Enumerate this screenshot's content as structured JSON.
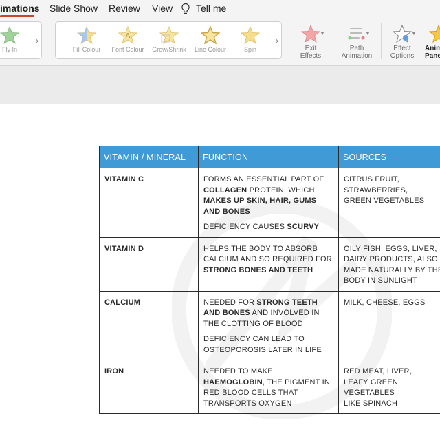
{
  "tabs": [
    {
      "label": "imations",
      "active": true
    },
    {
      "label": "Slide Show"
    },
    {
      "label": "Review"
    },
    {
      "label": "View"
    },
    {
      "label": "Tell me"
    }
  ],
  "ribbon": {
    "fly_in": "Fly In",
    "effects": [
      "Fill Colour",
      "Font Colour",
      "Grow/Shrink",
      "Line Colour",
      "Spin"
    ],
    "exit_effects": "Exit Effects",
    "path_animation": "Path Animation",
    "effect_options": "Effect Options",
    "animation_pane": "Animation Pane"
  },
  "table": {
    "headers": [
      "VITAMIN / MINERAL",
      "FUNCTION",
      "SOURCES"
    ],
    "rows": [
      {
        "name": "VITAMIN C",
        "function": [
          [
            {
              "t": "FORMS AN ESSENTIAL PART OF "
            },
            {
              "t": "COLLAGEN",
              "b": true
            },
            {
              "t": " PROTEIN, WHICH "
            },
            {
              "t": "MAKES UP SKIN, HAIR, GUMS AND BONES",
              "b": true
            }
          ],
          [
            {
              "t": "DEFICIENCY CAUSES "
            },
            {
              "t": "SCURVY",
              "b": true
            }
          ]
        ],
        "sources": [
          "CITRUS FRUIT,",
          "STRAWBERRIES,",
          "GREEN VEGETABLES"
        ]
      },
      {
        "name": "VITAMIN D",
        "function": [
          [
            {
              "t": "HELPS THE BODY TO ABSORB CALCIUM AND SO REQUIRED FOR "
            },
            {
              "t": "STRONG BONES AND TEETH",
              "b": true
            }
          ]
        ],
        "sources": [
          "OILY FISH, EGGS, LIVER,",
          "DAIRY PRODUCTS, ALSO",
          "MADE NATURALLY BY THE",
          "BODY IN SUNLIGHT"
        ]
      },
      {
        "name": "CALCIUM",
        "function": [
          [
            {
              "t": "NEEDED FOR "
            },
            {
              "t": "STRONG TEETH AND BONES",
              "b": true
            },
            {
              "t": " AND INVOLVED IN THE CLOTTING OF BLOOD"
            }
          ],
          [
            {
              "t": "DEFICIENCY CAN LEAD TO OSTEOPOROSIS LATER IN LIFE"
            }
          ]
        ],
        "sources": [
          "MILK, CHEESE, EGGS"
        ]
      },
      {
        "name": "IRON",
        "function": [
          [
            {
              "t": "NEEDED TO MAKE "
            },
            {
              "t": "HAEMOGLOBIN",
              "b": true
            },
            {
              "t": ", THE PIGMENT IN RED BLOOD CELLS THAT TRANSPORTS OXYGEN"
            }
          ]
        ],
        "sources": [
          "RED MEAT, LIVER,",
          "LEAFY GREEN",
          "VEGETABLES",
          "LIKE SPINACH"
        ]
      }
    ]
  },
  "colors": {
    "header_bg": "#3f9ad6",
    "tab_accent": "#c9452b"
  },
  "icons": {
    "tell_me": "lightbulb-icon",
    "effect": "star-icon"
  }
}
